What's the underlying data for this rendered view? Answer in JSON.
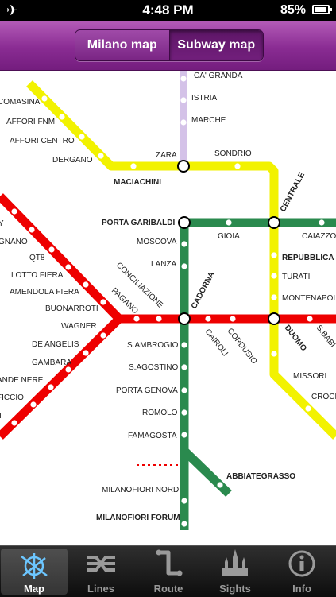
{
  "status": {
    "time": "4:48 PM",
    "battery": "85%",
    "airplane_glyph": "✈"
  },
  "nav": {
    "segments": [
      {
        "label": "Milano map",
        "active": false
      },
      {
        "label": "Subway map",
        "active": true
      }
    ]
  },
  "colors": {
    "yellow_line": "#f2f200",
    "red_line": "#ee0000",
    "green_line": "#2a8a4e",
    "lilac_line": "#d4c2e8",
    "tab_bar": "#1a1a1a",
    "nav_purple": "#8a2c93"
  },
  "map": {
    "stations": [
      {
        "key": "ca_granda",
        "label": "CA' GRANDA"
      },
      {
        "key": "istria",
        "label": "ISTRIA"
      },
      {
        "key": "marche",
        "label": "MARCHE"
      },
      {
        "key": "comasina",
        "label": "COMASINA"
      },
      {
        "key": "affori_fnm",
        "label": "AFFORI FNM"
      },
      {
        "key": "affori_centro",
        "label": "AFFORI CENTRO"
      },
      {
        "key": "dergano",
        "label": "DERGANO"
      },
      {
        "key": "zara",
        "label": "ZARA"
      },
      {
        "key": "sondrio",
        "label": "SONDRIO"
      },
      {
        "key": "maciachini",
        "label": "MACIACHINI"
      },
      {
        "key": "centrale",
        "label": "CENTRALE"
      },
      {
        "key": "porta_garibaldi",
        "label": "PORTA GARIBALDI"
      },
      {
        "key": "gioia",
        "label": "GIOIA"
      },
      {
        "key": "caiazzo",
        "label": "CAIAZZO"
      },
      {
        "key": "moscova",
        "label": "MOSCOVA"
      },
      {
        "key": "repubblica",
        "label": "REPUBBLICA"
      },
      {
        "key": "turati",
        "label": "TURATI"
      },
      {
        "key": "lanza",
        "label": "LANZA"
      },
      {
        "key": "montenapoleone",
        "label": "MONTENAPOL"
      },
      {
        "key": "conciliazione",
        "label": "CONCILIAZIONE"
      },
      {
        "key": "pagano",
        "label": "PAGANO"
      },
      {
        "key": "cadorna",
        "label": "CADORNA"
      },
      {
        "key": "duomo",
        "label": "DUOMO"
      },
      {
        "key": "san_babila",
        "label": "S.BABI"
      },
      {
        "key": "cairoli",
        "label": "CAIROLI"
      },
      {
        "key": "cordusio",
        "label": "CORDUSIO"
      },
      {
        "key": "rho_fiera",
        "label": "Y"
      },
      {
        "key": "bisceglie",
        "label": "GNANO"
      },
      {
        "key": "qt8",
        "label": "QT8"
      },
      {
        "key": "lotto_fiera",
        "label": "LOTTO FIERA"
      },
      {
        "key": "amendola_fiera",
        "label": "AMENDOLA FIERA"
      },
      {
        "key": "buonarroti",
        "label": "BUONARROTI"
      },
      {
        "key": "wagner",
        "label": "WAGNER"
      },
      {
        "key": "de_angelis",
        "label": "DE ANGELIS"
      },
      {
        "key": "gambara",
        "label": "GAMBARA"
      },
      {
        "key": "bande_nere",
        "label": "ANDE NERE"
      },
      {
        "key": "primaticcio",
        "label": "FICCIO"
      },
      {
        "key": "inganni",
        "label": "I"
      },
      {
        "key": "s_ambrogio",
        "label": "S.AMBROGIO"
      },
      {
        "key": "s_agostino",
        "label": "S.AGOSTINO"
      },
      {
        "key": "porta_genova",
        "label": "PORTA GENOVA"
      },
      {
        "key": "romolo",
        "label": "ROMOLO"
      },
      {
        "key": "famagosta",
        "label": "FAMAGOSTA"
      },
      {
        "key": "missori",
        "label": "MISSORI"
      },
      {
        "key": "crocetta",
        "label": "CROCE"
      },
      {
        "key": "abbiategrasso",
        "label": "ABBIATEGRASSO"
      },
      {
        "key": "milanofiori_nord",
        "label": "MILANOFIORI NORD"
      },
      {
        "key": "milanofiori_forum",
        "label": "MILANOFIORI FORUM"
      }
    ]
  },
  "tabs": [
    {
      "key": "map",
      "label": "Map",
      "icon": "map-icon",
      "selected": true
    },
    {
      "key": "lines",
      "label": "Lines",
      "icon": "lines-icon",
      "selected": false
    },
    {
      "key": "route",
      "label": "Route",
      "icon": "route-icon",
      "selected": false
    },
    {
      "key": "sights",
      "label": "Sights",
      "icon": "sights-icon",
      "selected": false
    },
    {
      "key": "info",
      "label": "Info",
      "icon": "info-icon",
      "selected": false
    }
  ]
}
